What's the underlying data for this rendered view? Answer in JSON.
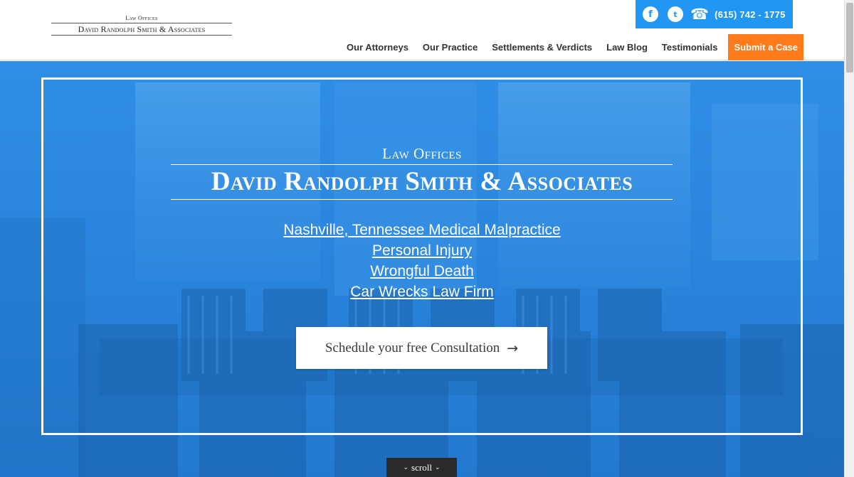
{
  "header": {
    "logo": {
      "top": "Law Offices",
      "main": "David Randolph Smith & Associates"
    },
    "topbar": {
      "facebook_glyph": "f",
      "twitter_glyph": "t",
      "phone_glyph": "☎",
      "phone": "(615) 742 - 1775",
      "color": "#2196f3"
    },
    "nav": [
      {
        "label": "Our Attorneys"
      },
      {
        "label": "Our Practice"
      },
      {
        "label": "Settlements & Verdicts"
      },
      {
        "label": "Law Blog"
      },
      {
        "label": "Testimonials"
      }
    ],
    "cta": {
      "label": "Submit a Case",
      "color": "#ff7a1a"
    }
  },
  "hero": {
    "kicker": "Law Offices",
    "title": "David Randolph Smith & Associates",
    "links": [
      "Nashville, Tennessee Medical Malpractice",
      "Personal Injury",
      "Wrongful Death",
      "Car Wrecks Law Firm"
    ],
    "button": {
      "label": "Schedule your free Consultation",
      "arrow": "→"
    },
    "scroll": {
      "label": "scroll",
      "chevron": "⌄"
    }
  },
  "icons": {
    "facebook": "facebook-icon",
    "twitter": "twitter-icon",
    "phone": "phone-icon",
    "arrow": "arrow-right-icon",
    "chevron": "chevron-down-icon"
  }
}
